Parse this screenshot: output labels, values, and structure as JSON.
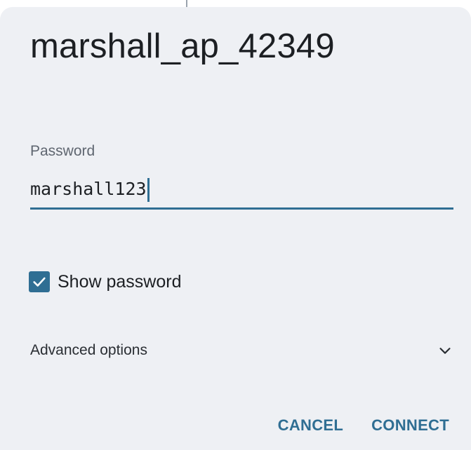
{
  "dialog": {
    "title": "marshall_ap_42349"
  },
  "password": {
    "label": "Password",
    "value": "marshall123"
  },
  "show_password": {
    "label": "Show password",
    "checked": true
  },
  "advanced": {
    "label": "Advanced options",
    "icon": "chevron-down-icon"
  },
  "actions": {
    "cancel_label": "CANCEL",
    "connect_label": "CONNECT"
  },
  "colors": {
    "accent": "#2f6e93",
    "dialog_bg": "#eef0f4",
    "text_primary": "#1c1f23",
    "text_secondary": "#5f6670"
  }
}
